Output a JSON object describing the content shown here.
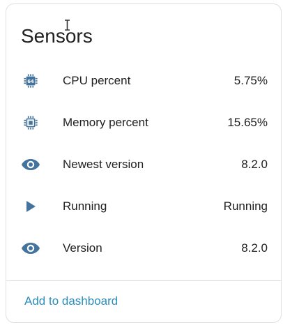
{
  "card": {
    "title": "Sensors"
  },
  "sensors": [
    {
      "icon": "chip-64-icon",
      "label": "CPU percent",
      "value": "5.75%"
    },
    {
      "icon": "memory-chip-icon",
      "label": "Memory percent",
      "value": "15.65%"
    },
    {
      "icon": "eye-icon",
      "label": "Newest version",
      "value": "8.2.0"
    },
    {
      "icon": "play-icon",
      "label": "Running",
      "value": "Running"
    },
    {
      "icon": "eye-icon",
      "label": "Version",
      "value": "8.2.0"
    }
  ],
  "footer": {
    "add_label": "Add to dashboard"
  },
  "colors": {
    "icon": "#44739e",
    "link": "#2a8dbf",
    "text": "#212121",
    "divider": "#e0e0e0"
  }
}
